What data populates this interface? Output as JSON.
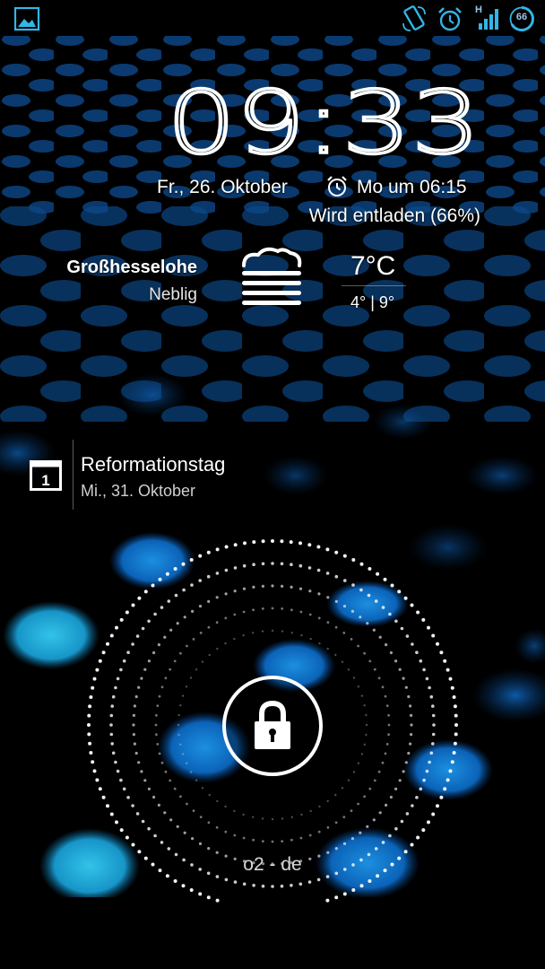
{
  "status_bar": {
    "network_type": "H",
    "battery_level": "66",
    "icons": [
      "gallery-icon",
      "screen-rotation-icon",
      "alarm-icon",
      "signal-icon",
      "battery-icon"
    ],
    "icon_color": "#33b5e5"
  },
  "clock": {
    "time": "09:33"
  },
  "info": {
    "date": "Fr., 26. Oktober",
    "next_alarm": "Mo um 06:15",
    "battery_status": "Wird entladen (66%)"
  },
  "weather": {
    "location": "Großhesselohe",
    "condition": "Neblig",
    "temperature": "7°C",
    "range": "4° | 9°",
    "icon": "fog-icon"
  },
  "calendar": {
    "icon_day": "1",
    "event_title": "Reformationstag",
    "event_date": "Mi., 31. Oktober"
  },
  "lockscreen": {
    "lock_icon": "lock-icon",
    "carrier": "o2 - de"
  }
}
